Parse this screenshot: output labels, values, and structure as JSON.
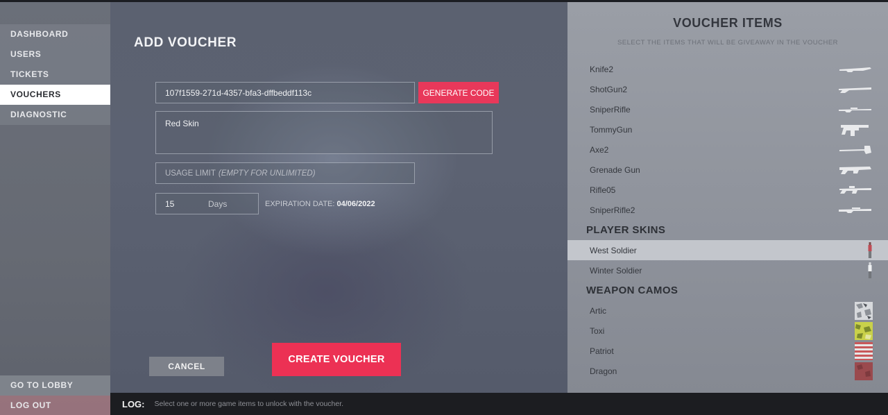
{
  "sidebar": {
    "items": [
      {
        "label": "DASHBOARD"
      },
      {
        "label": "USERS"
      },
      {
        "label": "TICKETS"
      },
      {
        "label": "VOUCHERS"
      },
      {
        "label": "DIAGNOSTIC"
      }
    ],
    "active": "VOUCHERS",
    "bottom": [
      {
        "label": "GO TO LOBBY"
      },
      {
        "label": "LOG OUT"
      }
    ]
  },
  "form": {
    "title": "ADD VOUCHER",
    "code_value": "107f1559-271d-4357-bfa3-dffbeddf113c",
    "generate_label": "GENERATE CODE",
    "name_value": "Red Skin",
    "usage_placeholder": "USAGE LIMIT",
    "usage_hint": "(EMPTY FOR UNLIMITED)",
    "days_value": "15",
    "days_unit": "Days",
    "expiration_label": "EXPIRATION DATE:",
    "expiration_value": "04/06/2022",
    "cancel_label": "CANCEL",
    "create_label": "CREATE VOUCHER"
  },
  "panel": {
    "title": "VOUCHER ITEMS",
    "subtitle": "SELECT THE ITEMS THAT WILL BE GIVEAWAY IN THE VOUCHER",
    "weapons": [
      {
        "name": "Knife2",
        "icon": "knife-icon"
      },
      {
        "name": "ShotGun2",
        "icon": "shotgun-icon"
      },
      {
        "name": "SniperRifle",
        "icon": "sniper-rifle-icon"
      },
      {
        "name": "TommyGun",
        "icon": "tommy-gun-icon"
      },
      {
        "name": "Axe2",
        "icon": "axe-icon"
      },
      {
        "name": "Grenade Gun",
        "icon": "grenade-gun-icon"
      },
      {
        "name": "Rifle05",
        "icon": "rifle-icon"
      },
      {
        "name": "SniperRifle2",
        "icon": "sniper-rifle-icon"
      }
    ],
    "skins_title": "PLAYER SKINS",
    "skins": [
      {
        "name": "West Soldier",
        "selected": true,
        "icon": "soldier-figure-icon"
      },
      {
        "name": "Winter Soldier",
        "selected": false,
        "icon": "soldier-figure-icon"
      }
    ],
    "camos_title": "WEAPON CAMOS",
    "camos": [
      {
        "name": "Artic",
        "color": "#d7d9dc",
        "icon": "artic-camo-swatch"
      },
      {
        "name": "Toxi",
        "color": "#c9d14a",
        "icon": "toxi-camo-swatch"
      },
      {
        "name": "Patriot",
        "color": "#c8585a",
        "icon": "patriot-camo-swatch"
      },
      {
        "name": "Dragon",
        "color": "#9a4a4e",
        "icon": "dragon-camo-swatch"
      }
    ]
  },
  "log": {
    "label": "LOG:",
    "text": "Select one or more game items to unlock with the voucher."
  },
  "colors": {
    "accent": "#ec3154",
    "selected_row": "#c3c6cc",
    "log_bar": "#1c1d21"
  }
}
